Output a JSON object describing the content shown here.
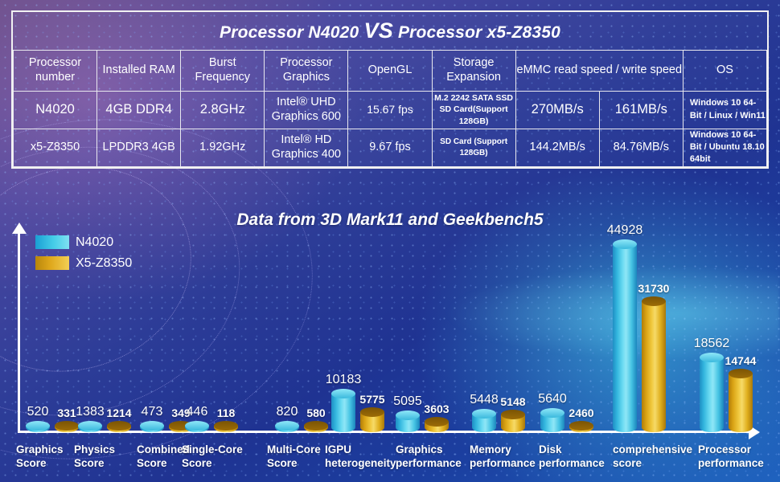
{
  "table": {
    "title_prefix": "Processor N4020 ",
    "title_vs": "VS",
    "title_suffix": " Processor x5-Z8350",
    "headers": [
      "Processor\nnumber",
      "Installed\nRAM",
      "Burst\nFrequency",
      "Processor Graphics",
      "OpenGL",
      "Storage\nExpansion",
      "eMMC read speed\n/ write speed",
      "OS"
    ],
    "rows": [
      {
        "processor_number": "N4020",
        "installed_ram": "4GB DDR4",
        "burst_frequency": "2.8GHz",
        "processor_graphics": "Intel® UHD Graphics 600",
        "opengl": "15.67 fps",
        "storage_expansion": "M.2 2242 SATA SSD\nSD Card(Support 128GB)",
        "emmc_read": "270MB/s",
        "emmc_write": "161MB/s",
        "os": "Windows 10\n64-Bit / Linux / Win11"
      },
      {
        "processor_number": "x5-Z8350",
        "installed_ram": "LPDDR3 4GB",
        "burst_frequency": "1.92GHz",
        "processor_graphics": "Intel® HD Graphics 400",
        "opengl": "9.67 fps",
        "storage_expansion": "SD Card (Support 128GB)",
        "emmc_read": "144.2MB/s",
        "emmc_write": "84.76MB/s",
        "os": "Windows 10 64-Bit /\nUbuntu 18.10 64bit"
      }
    ]
  },
  "chart_data": {
    "type": "bar",
    "title": "Data from 3D Mark11 and Geekbench5",
    "xlabel": "",
    "ylabel": "",
    "grid": false,
    "legend_position": "top-left",
    "ylim": [
      0,
      44928
    ],
    "categories": [
      "Graphics\nScore",
      "Physics\nScore",
      "Combined\nScore",
      "Single-Core\nScore",
      "Multi-Core\nScore",
      "IGPU\nheterogeneity",
      "Graphics\nperformance",
      "Memory\nperformance",
      "Disk\nperformance",
      "comprehensive\nscore",
      "Processor\nperformance"
    ],
    "series": [
      {
        "name": "N4020",
        "color": "#46cde8",
        "values": [
          520,
          1383,
          473,
          446,
          820,
          10183,
          5095,
          5448,
          5640,
          44928,
          18562
        ]
      },
      {
        "name": "X5-Z8350",
        "color": "#e0b022",
        "values": [
          331,
          1214,
          349,
          118,
          580,
          5775,
          3603,
          5148,
          2460,
          31730,
          14744
        ]
      }
    ]
  }
}
